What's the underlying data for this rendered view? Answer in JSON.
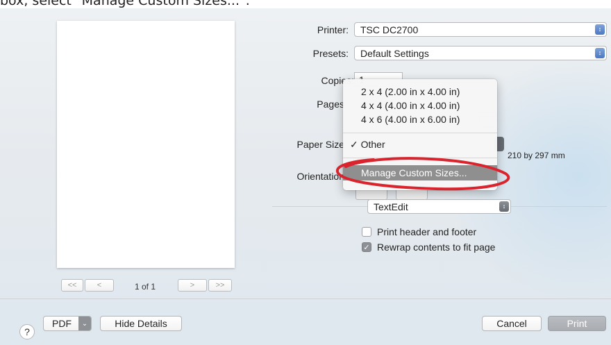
{
  "caption": "box, select \"Manage Custom Sizes...\".",
  "preview": {
    "page_count": "1 of 1",
    "first": "<<",
    "prev": "<",
    "next": ">",
    "last": ">>"
  },
  "printer": {
    "label": "Printer:",
    "value": "TSC DC2700"
  },
  "presets": {
    "label": "Presets:",
    "value": "Default Settings"
  },
  "copies": {
    "label": "Copies:",
    "value": "1"
  },
  "pages": {
    "label": "Pages"
  },
  "paper_size": {
    "label": "Paper Size",
    "dimensions": "210 by 297 mm"
  },
  "orientation": {
    "label": "Orientation"
  },
  "paper_menu": {
    "items": [
      "2 x 4 (2.00 in x 4.00 in)",
      "4 x 4 (4.00 in x 4.00 in)",
      "4 x 6 (4.00 in x 6.00 in)"
    ],
    "selected": "✓ Other",
    "manage": "Manage Custom Sizes..."
  },
  "app_section": {
    "value": "TextEdit"
  },
  "options": {
    "print_header_footer": {
      "label": "Print header and footer",
      "checked": false
    },
    "rewrap": {
      "label": "Rewrap contents to fit page",
      "checked": true
    }
  },
  "footer": {
    "help": "?",
    "pdf": "PDF",
    "hide_details": "Hide Details",
    "cancel": "Cancel",
    "print": "Print"
  },
  "colors": {
    "annotation": "#d9242e",
    "accent": "#4b78c4"
  }
}
